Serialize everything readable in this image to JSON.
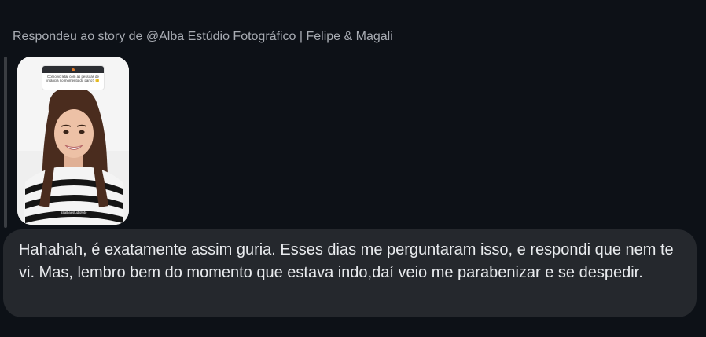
{
  "reply": {
    "header": "Respondeu ao story de @Alba Estúdio Fotográfico | Felipe & Magali"
  },
  "story": {
    "card_text": "Como vc lidar com as pessoas de infância no momento do parto? 🙃",
    "caption": "@albaestudiofoto"
  },
  "message": {
    "text": "Hahahah, é exatamente assim guria. Esses dias me perguntaram isso, e respondi que nem te vi. Mas, lembro bem do momento que estava indo,daí veio me parabenizar e se despedir."
  },
  "colors": {
    "background": "#0d1117",
    "bubble": "#25282d",
    "text": "#e9ebee",
    "muted": "#a8acb3"
  }
}
